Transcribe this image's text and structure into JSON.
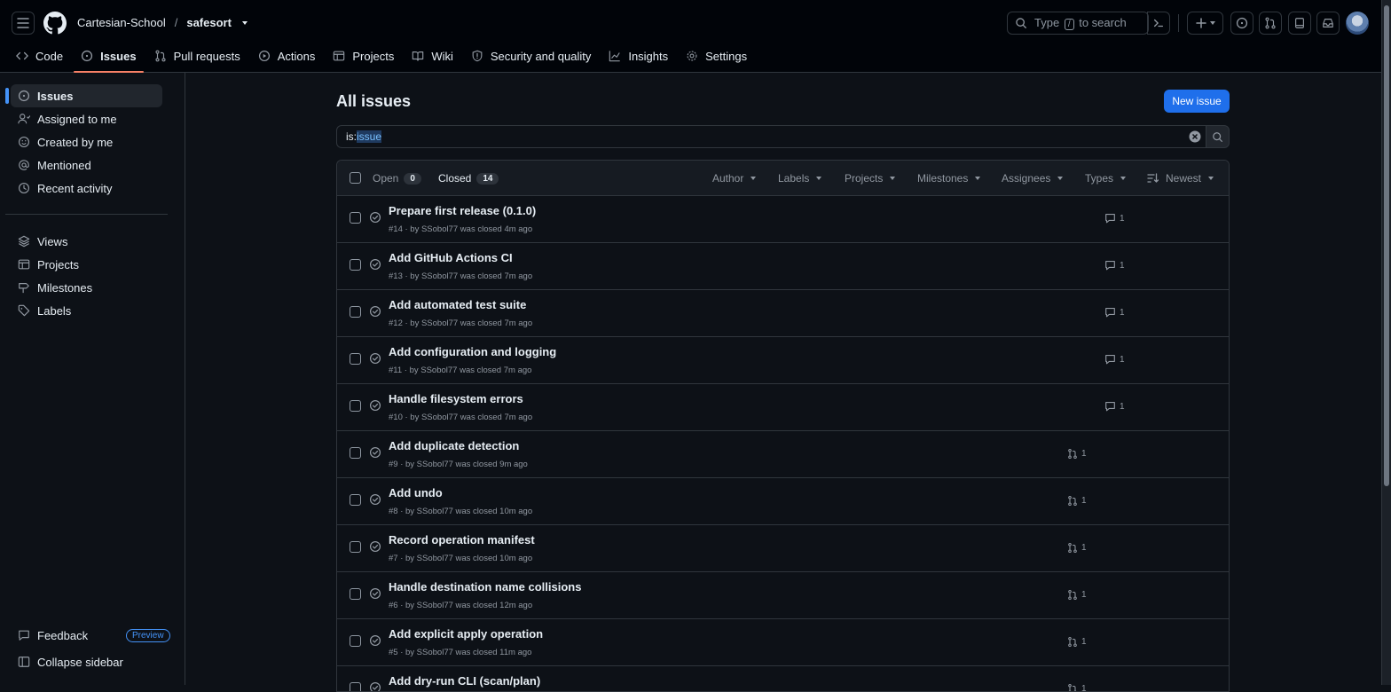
{
  "header": {
    "owner": "Cartesian-School",
    "separator": "/",
    "repo": "safesort",
    "search_prefix": "Type",
    "search_key": "/",
    "search_suffix": "to search"
  },
  "tabs": [
    {
      "label": "Code",
      "icon": "code-icon"
    },
    {
      "label": "Issues",
      "icon": "issue-opened-icon",
      "selected": true
    },
    {
      "label": "Pull requests",
      "icon": "git-pull-request-icon"
    },
    {
      "label": "Actions",
      "icon": "play-icon"
    },
    {
      "label": "Projects",
      "icon": "table-icon"
    },
    {
      "label": "Wiki",
      "icon": "book-icon"
    },
    {
      "label": "Security and quality",
      "icon": "shield-icon"
    },
    {
      "label": "Insights",
      "icon": "graph-icon"
    },
    {
      "label": "Settings",
      "icon": "gear-icon"
    }
  ],
  "sidebar": {
    "items": [
      {
        "label": "Issues",
        "icon": "issue-opened-icon",
        "active": true
      },
      {
        "label": "Assigned to me",
        "icon": "person-icon"
      },
      {
        "label": "Created by me",
        "icon": "smiley-icon"
      },
      {
        "label": "Mentioned",
        "icon": "mention-icon"
      },
      {
        "label": "Recent activity",
        "icon": "clock-icon"
      }
    ],
    "items2": [
      {
        "label": "Views",
        "icon": "stack-icon"
      },
      {
        "label": "Projects",
        "icon": "table-icon"
      },
      {
        "label": "Milestones",
        "icon": "milestone-icon"
      },
      {
        "label": "Labels",
        "icon": "tag-icon"
      }
    ],
    "feedback": "Feedback",
    "preview_badge": "Preview",
    "collapse": "Collapse sidebar"
  },
  "main": {
    "title": "All issues",
    "new_issue": "New issue",
    "query_prefix": "is:",
    "query_value": "issue",
    "open_label": "Open",
    "open_count": "0",
    "closed_label": "Closed",
    "closed_count": "14",
    "filters": [
      "Author",
      "Labels",
      "Projects",
      "Milestones",
      "Assignees",
      "Types"
    ],
    "sort_label": "Newest"
  },
  "issues": [
    {
      "title": "Prepare first release (0.1.0)",
      "meta": "#14 · by SSobol77 was closed 4m ago",
      "kind": "comment",
      "count": "1"
    },
    {
      "title": "Add GitHub Actions CI",
      "meta": "#13 · by SSobol77 was closed 7m ago",
      "kind": "comment",
      "count": "1"
    },
    {
      "title": "Add automated test suite",
      "meta": "#12 · by SSobol77 was closed 7m ago",
      "kind": "comment",
      "count": "1"
    },
    {
      "title": "Add configuration and logging",
      "meta": "#11 · by SSobol77 was closed 7m ago",
      "kind": "comment",
      "count": "1"
    },
    {
      "title": "Handle filesystem errors",
      "meta": "#10 · by SSobol77 was closed 7m ago",
      "kind": "comment",
      "count": "1"
    },
    {
      "title": "Add duplicate detection",
      "meta": "#9 · by SSobol77 was closed 9m ago",
      "kind": "pr",
      "count": "1"
    },
    {
      "title": "Add undo",
      "meta": "#8 · by SSobol77 was closed 10m ago",
      "kind": "pr",
      "count": "1"
    },
    {
      "title": "Record operation manifest",
      "meta": "#7 · by SSobol77 was closed 10m ago",
      "kind": "pr",
      "count": "1"
    },
    {
      "title": "Handle destination name collisions",
      "meta": "#6 · by SSobol77 was closed 12m ago",
      "kind": "pr",
      "count": "1"
    },
    {
      "title": "Add explicit apply operation",
      "meta": "#5 · by SSobol77 was closed 11m ago",
      "kind": "pr",
      "count": "1"
    },
    {
      "title": "Add dry-run CLI (scan/plan)",
      "meta": "",
      "kind": "pr",
      "count": "1"
    }
  ]
}
